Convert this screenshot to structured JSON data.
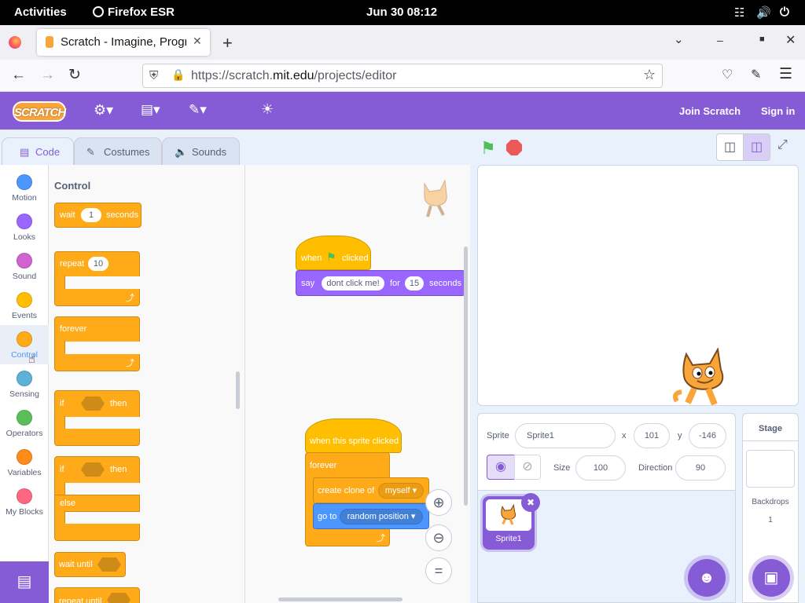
{
  "system": {
    "activities": "Activities",
    "app": "Firefox ESR",
    "clock": "Jun 30  08:12"
  },
  "browser": {
    "tab_title": "Scratch - Imagine, Progra",
    "url_prefix": "https://scratch.",
    "url_domain": "mit.edu",
    "url_path": "/projects/editor"
  },
  "menu": {
    "logo": "SCRATCH",
    "join": "Join Scratch",
    "signin": "Sign in"
  },
  "tabs": {
    "code": "Code",
    "costumes": "Costumes",
    "sounds": "Sounds"
  },
  "categories": [
    {
      "label": "Motion",
      "color": "#4c97ff"
    },
    {
      "label": "Looks",
      "color": "#9966ff"
    },
    {
      "label": "Sound",
      "color": "#cf63cf"
    },
    {
      "label": "Events",
      "color": "#ffbf00"
    },
    {
      "label": "Control",
      "color": "#ffab19"
    },
    {
      "label": "Sensing",
      "color": "#5cb1d6"
    },
    {
      "label": "Operators",
      "color": "#59c059"
    },
    {
      "label": "Variables",
      "color": "#ff8c1a"
    },
    {
      "label": "My Blocks",
      "color": "#ff6680"
    }
  ],
  "palette": {
    "heading": "Control",
    "wait": "wait",
    "wait_val": "1",
    "seconds": "seconds",
    "repeat": "repeat",
    "repeat_val": "10",
    "forever": "forever",
    "if": "if",
    "then": "then",
    "else": "else",
    "wait_until": "wait until",
    "repeat_until": "repeat until"
  },
  "script1": {
    "when": "when",
    "clicked": "clicked",
    "say": "say",
    "say_text": "dont click me!",
    "for": "for",
    "secs_val": "15",
    "seconds": "seconds"
  },
  "script2": {
    "hat": "when this sprite clicked",
    "forever": "forever",
    "clone": "create clone of",
    "clone_target": "myself",
    "goto": "go to",
    "goto_target": "random position"
  },
  "sprite_info": {
    "sprite_label": "Sprite",
    "sprite_name": "Sprite1",
    "x_label": "x",
    "x": "101",
    "y_label": "y",
    "y": "-146",
    "size_label": "Size",
    "size": "100",
    "dir_label": "Direction",
    "direction": "90",
    "thumb_name": "Sprite1"
  },
  "stage_panel": {
    "title": "Stage",
    "backdrops_label": "Backdrops",
    "backdrops_count": "1"
  },
  "colors": {
    "scratch_purple": "#855cd6",
    "control": "#ffab19",
    "looks": "#9966ff",
    "motion": "#4c97ff",
    "events": "#ffbf00"
  }
}
